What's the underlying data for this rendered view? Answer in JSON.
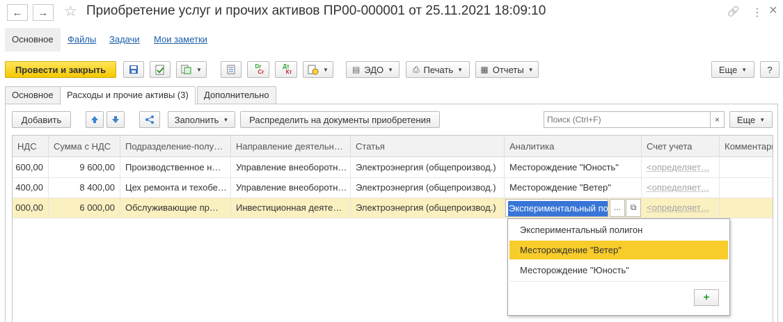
{
  "window": {
    "title": "Приобретение услуг и прочих активов ПР00-000001 от 25.11.2021 18:09:10",
    "back_icon": "←",
    "forward_icon": "→",
    "star_icon": "☆",
    "link_icon": "🔗",
    "more_icon": "⋮",
    "close_icon": "×"
  },
  "sections": {
    "main": "Основное",
    "files": "Файлы",
    "tasks": "Задачи",
    "notes": "Мои заметки"
  },
  "toolbar": {
    "post_close": "Провести и закрыть",
    "edo": "ЭДО",
    "print": "Печать",
    "reports": "Отчеты",
    "more": "Еще",
    "help": "?",
    "dr_top": "Dr",
    "dr_bottom": "Cr",
    "dt_top": "Дт",
    "dt_bottom": "Кт"
  },
  "form_tabs": [
    {
      "label": "Основное"
    },
    {
      "label": "Расходы и прочие активы (3)"
    },
    {
      "label": "Дополнительно"
    }
  ],
  "table_toolbar": {
    "add": "Добавить",
    "fill": "Заполнить",
    "distribute": "Распределить на документы приобретения",
    "more": "Еще",
    "search_placeholder": "Поиск (Ctrl+F)",
    "clear": "×"
  },
  "table": {
    "columns": [
      "НДС",
      "Сумма с НДС",
      "Подразделение-полу…",
      "Направление деятельн…",
      "Статья",
      "Аналитика",
      "Счет учета",
      "Комментарий"
    ],
    "rows": [
      {
        "vat": "600,00",
        "sum": "9 600,00",
        "dept": "Производственное н…",
        "direction": "Управление внеоборотн…",
        "item": "Электроэнергия (общепроизвод.)",
        "analytics": "Месторождение \"Юность\"",
        "account": "<определяет…",
        "comment": ""
      },
      {
        "vat": "400,00",
        "sum": "8 400,00",
        "dept": "Цех ремонта и техобе…",
        "direction": "Управление внеоборотн…",
        "item": "Электроэнергия (общепроизвод.)",
        "analytics": "Месторождение \"Ветер\"",
        "account": "<определяет…",
        "comment": ""
      },
      {
        "vat": "000,00",
        "sum": "6 000,00",
        "dept": "Обслуживающие пр…",
        "direction": "Инвестиционная деяте…",
        "item": "Электроэнергия (общепроизвод.)",
        "analytics": "Экспериментальный по",
        "account": "<определяет…",
        "comment": ""
      }
    ],
    "edit_more": "...",
    "edit_open": "⧉"
  },
  "dropdown": {
    "items": [
      "Экспериментальный полигон",
      "Месторождение \"Ветер\"",
      "Месторождение \"Юность\""
    ],
    "highlighted": 1,
    "add": "+"
  }
}
